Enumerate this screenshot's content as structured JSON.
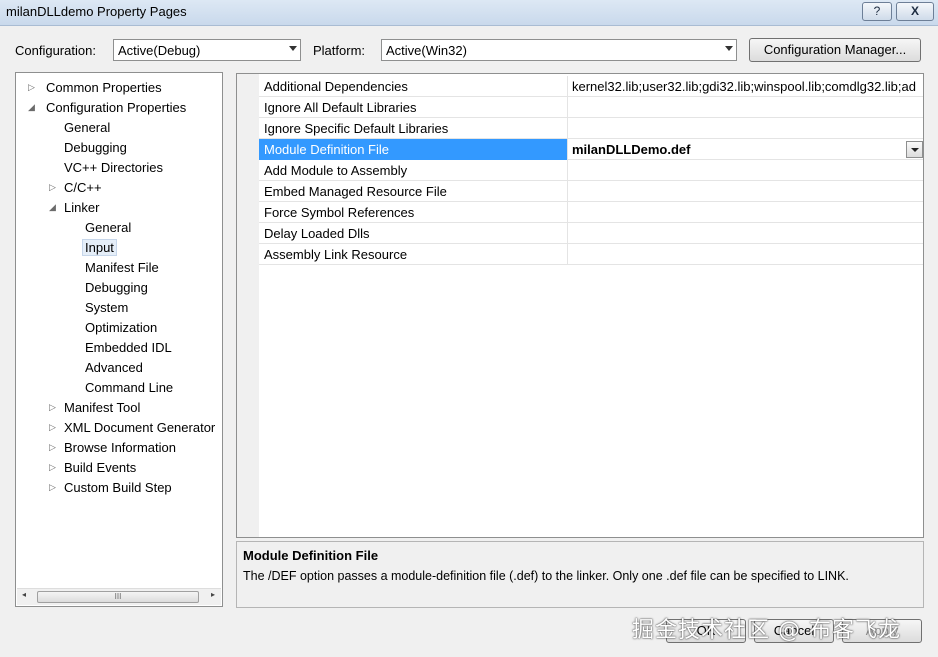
{
  "window": {
    "title": "milanDLLdemo Property Pages",
    "help_label": "?",
    "close_label": "X"
  },
  "toolbar": {
    "configuration_label": "Configuration:",
    "configuration_value": "Active(Debug)",
    "platform_label": "Platform:",
    "platform_value": "Active(Win32)",
    "config_manager_label": "Configuration Manager..."
  },
  "tree": {
    "items": [
      {
        "label": "Common Properties",
        "expander": "▷"
      },
      {
        "label": "Configuration Properties",
        "expander": "◢"
      },
      {
        "label": "General",
        "expander": ""
      },
      {
        "label": "Debugging",
        "expander": ""
      },
      {
        "label": "VC++ Directories",
        "expander": ""
      },
      {
        "label": "C/C++",
        "expander": "▷"
      },
      {
        "label": "Linker",
        "expander": "◢"
      },
      {
        "label": "General",
        "expander": ""
      },
      {
        "label": "Input",
        "expander": ""
      },
      {
        "label": "Manifest File",
        "expander": ""
      },
      {
        "label": "Debugging",
        "expander": ""
      },
      {
        "label": "System",
        "expander": ""
      },
      {
        "label": "Optimization",
        "expander": ""
      },
      {
        "label": "Embedded IDL",
        "expander": ""
      },
      {
        "label": "Advanced",
        "expander": ""
      },
      {
        "label": "Command Line",
        "expander": ""
      },
      {
        "label": "Manifest Tool",
        "expander": "▷"
      },
      {
        "label": "XML Document Generator",
        "expander": "▷"
      },
      {
        "label": "Browse Information",
        "expander": "▷"
      },
      {
        "label": "Build Events",
        "expander": "▷"
      },
      {
        "label": "Custom Build Step",
        "expander": "▷"
      }
    ],
    "scroll_left": "◂",
    "scroll_right": "▸",
    "scroll_grip": "III"
  },
  "properties": {
    "rows": [
      {
        "name": "Additional Dependencies",
        "value": "kernel32.lib;user32.lib;gdi32.lib;winspool.lib;comdlg32.lib;ad"
      },
      {
        "name": "Ignore All Default Libraries",
        "value": ""
      },
      {
        "name": "Ignore Specific Default Libraries",
        "value": ""
      },
      {
        "name": "Module Definition File",
        "value": "milanDLLDemo.def"
      },
      {
        "name": "Add Module to Assembly",
        "value": ""
      },
      {
        "name": "Embed Managed Resource File",
        "value": ""
      },
      {
        "name": "Force Symbol References",
        "value": ""
      },
      {
        "name": "Delay Loaded Dlls",
        "value": ""
      },
      {
        "name": "Assembly Link Resource",
        "value": ""
      }
    ]
  },
  "description": {
    "title": "Module Definition File",
    "text": "The /DEF option passes a module-definition file (.def) to the linker. Only one .def file can be specified to LINK."
  },
  "footer": {
    "ok_label": "OK",
    "cancel_label": "Cancel",
    "apply_label": "Apply"
  },
  "watermark": "掘金技术社区 @ 布客飞龙",
  "colors": {
    "selection": "#3399ff",
    "tree_selection": "#e5eef8",
    "dialog_bg": "#f0f0f0"
  }
}
